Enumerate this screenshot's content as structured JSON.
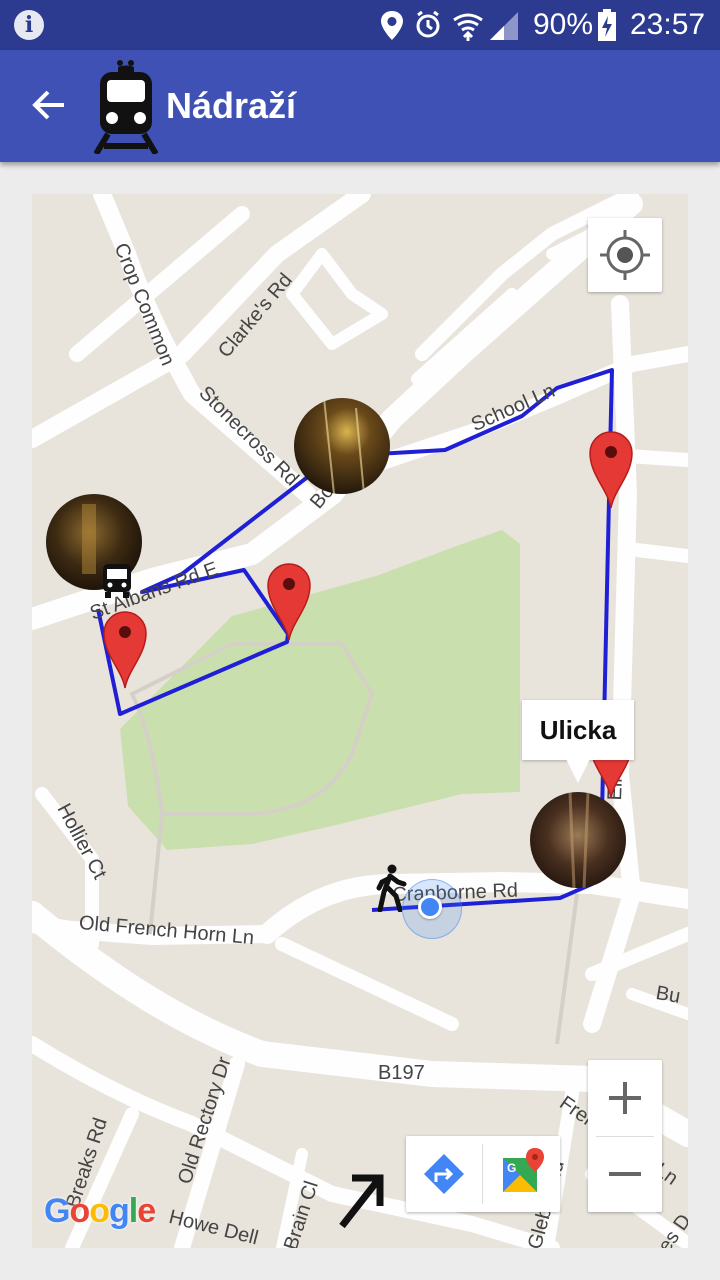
{
  "status_bar": {
    "battery": "90%",
    "time": "23:57"
  },
  "app_bar": {
    "title": "Nádraží"
  },
  "map": {
    "roads": [
      "Crop Common",
      "Clarke's Rd",
      "Stonecross Rd",
      "School Ln",
      "St Albans Rd E",
      "Bo",
      "Hollier Ct",
      "Old French Horn Ln",
      "Cranborne Rd",
      "B197",
      "Old Rectory Dr",
      "Breaks Rd",
      "Howe Dell",
      "Brain Cl",
      "Glebeland",
      "French Horn Ln",
      "Ellerd Rd",
      "Bu",
      "es D"
    ],
    "marker_tooltip": "Ulicka",
    "attribution": {
      "g1": "G",
      "o1": "o",
      "o2": "o",
      "g2": "g",
      "l": "l",
      "e": "e"
    },
    "colors": {
      "route": "#1f1fd6",
      "park": "#cadfae",
      "marker": "#e53935",
      "my_location": "#4285f4"
    }
  }
}
